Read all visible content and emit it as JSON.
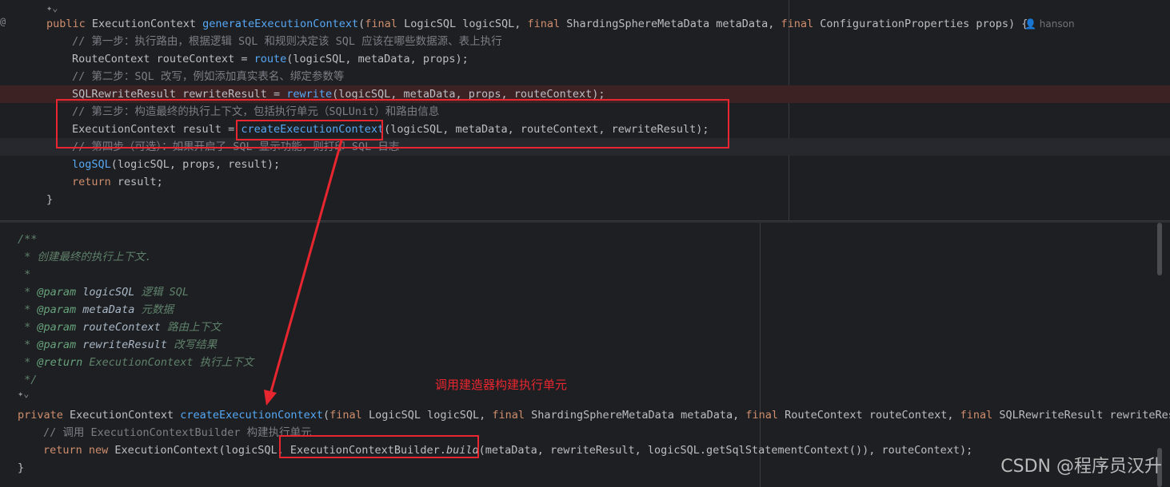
{
  "top": {
    "author": "hanson",
    "lines": [
      {
        "parts": [
          {
            "t": "public ",
            "c": "kw"
          },
          {
            "t": "ExecutionContext "
          },
          {
            "t": "generateExecutionContext",
            "c": "fn"
          },
          {
            "t": "("
          },
          {
            "t": "final ",
            "c": "kw"
          },
          {
            "t": "LogicSQL logicSQL, "
          },
          {
            "t": "final ",
            "c": "kw"
          },
          {
            "t": "ShardingSphereMetaData metaData, "
          },
          {
            "t": "final ",
            "c": "kw"
          },
          {
            "t": "ConfigurationProperties props) {"
          }
        ]
      },
      {
        "parts": [
          {
            "t": "// 第一步：执行路由，根据逻辑 SQL 和规则决定该 SQL 应该在哪些数据源、表上执行",
            "c": "cm"
          }
        ]
      },
      {
        "parts": [
          {
            "t": "RouteContext routeContext = "
          },
          {
            "t": "route",
            "c": "fn"
          },
          {
            "t": "(logicSQL, metaData, props);"
          }
        ]
      },
      {
        "parts": [
          {
            "t": "// 第二步：SQL 改写，例如添加真实表名、绑定参数等",
            "c": "cm"
          }
        ]
      },
      {
        "parts": [
          {
            "t": "SQLRewriteResult rewriteResult = "
          },
          {
            "t": "rewrite",
            "c": "fn"
          },
          {
            "t": "(logicSQL, metaData, props, routeContext);"
          }
        ]
      },
      {
        "parts": [
          {
            "t": "// 第三步：构造最终的执行上下文，包括执行单元（SQLUnit）和路由信息",
            "c": "cm"
          }
        ]
      },
      {
        "parts": [
          {
            "t": "ExecutionContext result = "
          },
          {
            "t": "createExecutionContext",
            "c": "fn"
          },
          {
            "t": "(logicSQL, metaData, routeContext, rewriteResult);"
          }
        ]
      },
      {
        "parts": [
          {
            "t": "// 第四步（可选）：如果开启了 SQL 显示功能，则打印 SQL 日志",
            "c": "cm"
          }
        ]
      },
      {
        "parts": [
          {
            "t": "logSQL",
            "c": "fn"
          },
          {
            "t": "(logicSQL, props, result);"
          }
        ]
      },
      {
        "parts": [
          {
            "t": "return ",
            "c": "kw"
          },
          {
            "t": "result;"
          }
        ]
      },
      {
        "parts": [
          {
            "t": "}"
          }
        ]
      }
    ]
  },
  "bottom": {
    "lines": [
      {
        "parts": [
          {
            "t": "/**",
            "c": "doc"
          }
        ]
      },
      {
        "parts": [
          {
            "t": " * 创建最终的执行上下文.",
            "c": "doc"
          }
        ]
      },
      {
        "parts": [
          {
            "t": " *",
            "c": "doc"
          }
        ]
      },
      {
        "parts": [
          {
            "t": " * ",
            "c": "doc"
          },
          {
            "t": "@param ",
            "c": "tag"
          },
          {
            "t": "logicSQL ",
            "c": "pn"
          },
          {
            "t": "逻辑 SQL",
            "c": "doc"
          }
        ]
      },
      {
        "parts": [
          {
            "t": " * ",
            "c": "doc"
          },
          {
            "t": "@param ",
            "c": "tag"
          },
          {
            "t": "metaData ",
            "c": "pn"
          },
          {
            "t": "元数据",
            "c": "doc"
          }
        ]
      },
      {
        "parts": [
          {
            "t": " * ",
            "c": "doc"
          },
          {
            "t": "@param ",
            "c": "tag"
          },
          {
            "t": "routeContext ",
            "c": "pn"
          },
          {
            "t": "路由上下文",
            "c": "doc"
          }
        ]
      },
      {
        "parts": [
          {
            "t": " * ",
            "c": "doc"
          },
          {
            "t": "@param ",
            "c": "tag"
          },
          {
            "t": "rewriteResult ",
            "c": "pn"
          },
          {
            "t": "改写结果",
            "c": "doc"
          }
        ]
      },
      {
        "parts": [
          {
            "t": " * ",
            "c": "doc"
          },
          {
            "t": "@return ",
            "c": "tag"
          },
          {
            "t": "ExecutionContext 执行上下文",
            "c": "doc"
          }
        ]
      },
      {
        "parts": [
          {
            "t": " */",
            "c": "doc"
          }
        ]
      },
      {
        "parts": []
      },
      {
        "parts": [
          {
            "t": "private ",
            "c": "kw"
          },
          {
            "t": "ExecutionContext "
          },
          {
            "t": "createExecutionContext",
            "c": "fn"
          },
          {
            "t": "("
          },
          {
            "t": "final ",
            "c": "kw"
          },
          {
            "t": "LogicSQL logicSQL, "
          },
          {
            "t": "final ",
            "c": "kw"
          },
          {
            "t": "ShardingSphereMetaData metaData, "
          },
          {
            "t": "final ",
            "c": "kw"
          },
          {
            "t": "RouteContext routeContext, "
          },
          {
            "t": "final ",
            "c": "kw"
          },
          {
            "t": "SQLRewriteResult rewriteResu"
          }
        ]
      },
      {
        "parts": [
          {
            "t": "// 调用 ExecutionContextBuilder 构建执行单元",
            "c": "cm"
          }
        ]
      },
      {
        "parts": [
          {
            "t": "return ",
            "c": "kw"
          },
          {
            "t": "new ",
            "c": "kw"
          },
          {
            "t": "ExecutionContext(logicSQL, ExecutionContextBuilder."
          },
          {
            "t": "build",
            "c": "it"
          },
          {
            "t": "(metaData, rewriteResult, logicSQL.getSqlStatementContext()), routeContext);"
          }
        ]
      },
      {
        "parts": [
          {
            "t": "}"
          }
        ]
      }
    ]
  },
  "annotation": "调用建造器构建执行单元",
  "watermark": "CSDN @程序员汉升"
}
